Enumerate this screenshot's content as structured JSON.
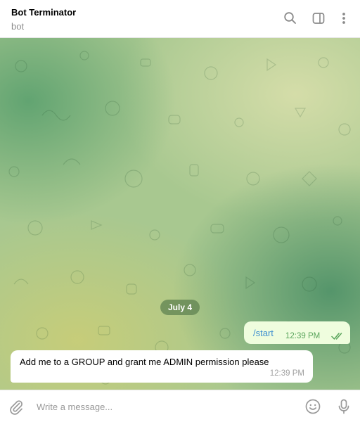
{
  "header": {
    "title": "Bot Terminator",
    "subtitle": "bot",
    "icons": [
      "search-icon",
      "sidebar-toggle-icon",
      "more-vertical-icon"
    ]
  },
  "chat": {
    "date_chip": "July 4",
    "messages": [
      {
        "direction": "outgoing",
        "text": "/start",
        "time": "12:39 PM",
        "status": "read"
      },
      {
        "direction": "incoming",
        "text": "Add me to a GROUP and grant me ADMIN permission please",
        "time": "12:39 PM"
      }
    ]
  },
  "composer": {
    "placeholder": "Write a message...",
    "value": "",
    "icons": [
      "paperclip-icon",
      "emoji-icon",
      "microphone-icon"
    ]
  },
  "colors": {
    "accent": "#3d8fd0",
    "outgoing_bubble": "#effdde",
    "read_ticks": "#5aa55c",
    "date_chip": "#5f8250"
  }
}
